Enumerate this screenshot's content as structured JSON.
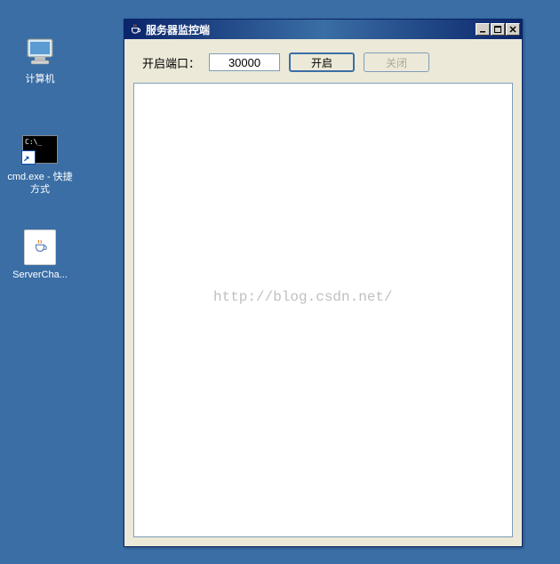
{
  "desktop": {
    "icons": [
      {
        "name": "computer",
        "label": "计算机"
      },
      {
        "name": "cmd",
        "label": "cmd.exe - 快捷方式"
      },
      {
        "name": "java-file",
        "label": "ServerCha..."
      }
    ]
  },
  "window": {
    "title": "服务器监控端",
    "port_label": "开启端口：",
    "port_value": "30000",
    "open_button": "开启",
    "close_button": "关闭"
  },
  "watermark": "http://blog.csdn.net/"
}
